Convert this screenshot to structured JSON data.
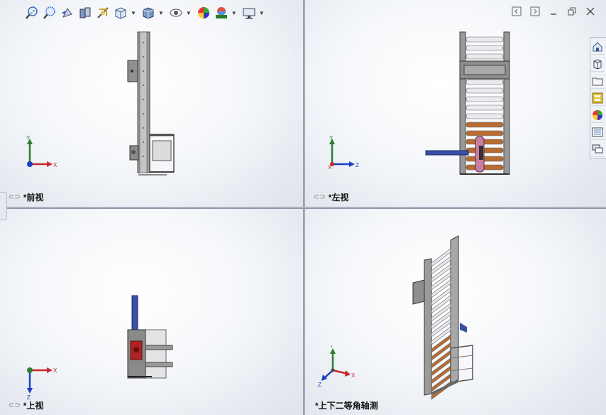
{
  "viewports": {
    "front": {
      "label": "*前视"
    },
    "left": {
      "label": "*左视"
    },
    "top": {
      "label": "*上视"
    },
    "iso": {
      "label": "*上下二等角轴测"
    }
  },
  "triad": {
    "x": "X",
    "y": "Y",
    "z": "Z"
  },
  "heads_up_toolbar": [
    {
      "name": "zoom-to-fit-icon"
    },
    {
      "name": "zoom-to-area-icon"
    },
    {
      "name": "previous-view-icon"
    },
    {
      "name": "section-view-icon"
    },
    {
      "name": "dynamic-annotation-icon"
    },
    {
      "name": "view-orientation-icon",
      "dropdown": true
    },
    {
      "name": "display-style-icon",
      "dropdown": true
    },
    {
      "name": "hide-show-items-icon",
      "dropdown": true
    },
    {
      "name": "edit-appearance-icon"
    },
    {
      "name": "apply-scene-icon",
      "dropdown": true
    },
    {
      "name": "view-settings-icon",
      "dropdown": true
    }
  ],
  "task_pane": [
    "home-icon",
    "design-library-icon",
    "file-explorer-icon",
    "view-palette-icon",
    "appearances-icon",
    "custom-properties-icon",
    "forum-icon"
  ],
  "colors": {
    "axis_x": "#c62828",
    "axis_y": "#2e7d32",
    "axis_z": "#1e3fbf",
    "frame": "#8c8c8c",
    "roller": "#e8eaee",
    "roller_brown": "#b86b33",
    "handle": "#3a4fa8"
  }
}
